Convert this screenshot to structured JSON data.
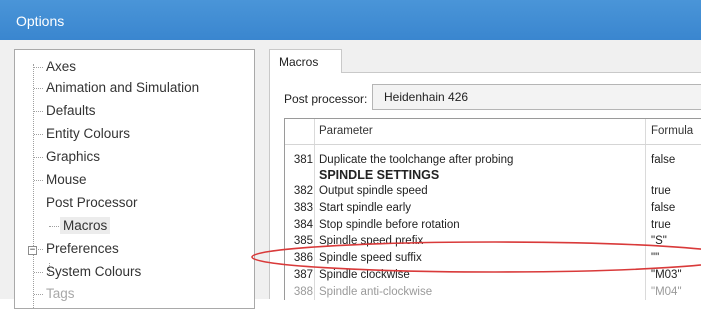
{
  "window": {
    "title": "Options"
  },
  "tree": {
    "items": [
      {
        "label": "Axes"
      },
      {
        "label": "Animation and Simulation"
      },
      {
        "label": "Defaults"
      },
      {
        "label": "Entity Colours"
      },
      {
        "label": "Graphics"
      },
      {
        "label": "Mouse"
      },
      {
        "label": "Post Processor",
        "expanded": true
      },
      {
        "label": "Macros",
        "selected": true
      },
      {
        "label": "Preferences"
      },
      {
        "label": "System Colours"
      },
      {
        "label": "Tags"
      }
    ],
    "expander_glyph": "−"
  },
  "tabs": [
    {
      "label": "Macros",
      "active": true
    }
  ],
  "post_processor": {
    "label": "Post processor:",
    "value": "Heidenhain 426"
  },
  "grid": {
    "columns": {
      "parameter": "Parameter",
      "formula": "Formula"
    },
    "rows": [
      {
        "num": "381",
        "param": "Duplicate the toolchange after probing",
        "formula": "false"
      },
      {
        "num": "",
        "param": "SPINDLE SETTINGS",
        "formula": "",
        "section": true
      },
      {
        "num": "382",
        "param": "Output spindle speed",
        "formula": "true"
      },
      {
        "num": "383",
        "param": "Start spindle early",
        "formula": "false"
      },
      {
        "num": "384",
        "param": "Stop spindle before rotation",
        "formula": "true"
      },
      {
        "num": "385",
        "param": "Spindle speed prefix",
        "formula": "\"S\""
      },
      {
        "num": "386",
        "param": "Spindle speed suffix",
        "formula": "\"\"",
        "highlighted": true
      },
      {
        "num": "387",
        "param": "Spindle clockwise",
        "formula": "\"M03\""
      },
      {
        "num": "388",
        "param": "Spindle anti-clockwise",
        "formula": "\"M04\""
      }
    ]
  },
  "colors": {
    "titlebar": "#3a86cf",
    "highlight_ring": "#d93a3a"
  }
}
